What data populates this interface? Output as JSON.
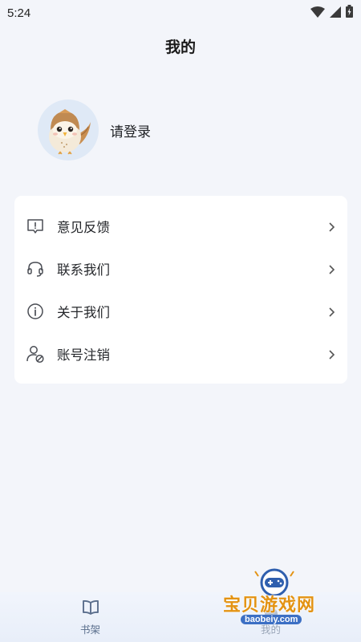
{
  "status_bar": {
    "time": "5:24",
    "icons": [
      "wifi-icon",
      "cellular-signal-icon",
      "battery-charging-icon"
    ]
  },
  "header": {
    "title": "我的"
  },
  "profile": {
    "avatar": "owl-avatar",
    "login_label": "请登录"
  },
  "menu": {
    "items": [
      {
        "label": "意见反馈",
        "icon": "feedback-icon"
      },
      {
        "label": "联系我们",
        "icon": "headset-icon"
      },
      {
        "label": "关于我们",
        "icon": "info-icon"
      },
      {
        "label": "账号注销",
        "icon": "user-cancel-icon"
      }
    ]
  },
  "bottom_nav": {
    "tabs": [
      {
        "label": "书架",
        "icon": "bookshelf-icon",
        "active": false
      },
      {
        "label": "我的",
        "icon": "profile-icon",
        "active": true
      }
    ]
  },
  "watermark": {
    "text": "宝贝游戏网",
    "url": "baobeiy.com"
  },
  "colors": {
    "background": "#f3f5fa",
    "card": "#ffffff",
    "nav_active_text": "#5a6e8c",
    "watermark_orange": "#e39313",
    "watermark_blue": "#3c6fc4"
  }
}
